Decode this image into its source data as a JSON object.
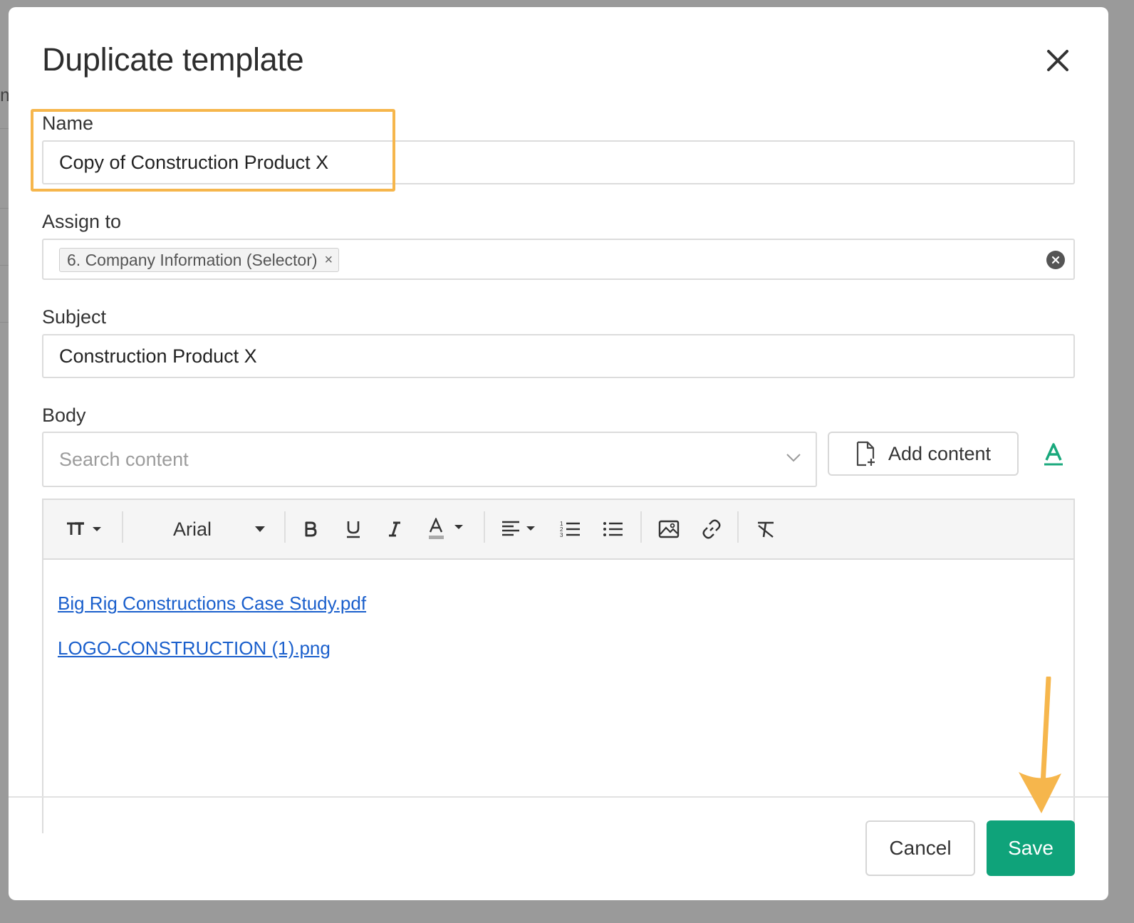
{
  "dialog": {
    "title": "Duplicate template",
    "close_icon": "close-icon"
  },
  "name_field": {
    "label": "Name",
    "value": "Copy of Construction Product X",
    "highlight_color": "#f6b64c"
  },
  "assign_field": {
    "label": "Assign to",
    "tags": [
      {
        "label": "6. Company Information (Selector)",
        "remove_glyph": "×"
      }
    ]
  },
  "subject_field": {
    "label": "Subject",
    "value": "Construction Product X"
  },
  "body_field": {
    "label": "Body",
    "search_placeholder": "Search content",
    "add_content_label": "Add content",
    "toolbar": {
      "font_family": "Arial",
      "items": [
        "text-size-icon",
        "bold-icon",
        "underline-icon",
        "italic-icon",
        "text-color-icon",
        "align-icon",
        "ordered-list-icon",
        "unordered-list-icon",
        "image-icon",
        "link-icon",
        "clear-format-icon"
      ]
    },
    "links": [
      "Big Rig Constructions Case Study.pdf",
      "LOGO-CONSTRUCTION (1).png"
    ],
    "link_color": "#1a5fcc"
  },
  "footer": {
    "cancel_label": "Cancel",
    "save_label": "Save",
    "save_color": "#0fa37a"
  }
}
